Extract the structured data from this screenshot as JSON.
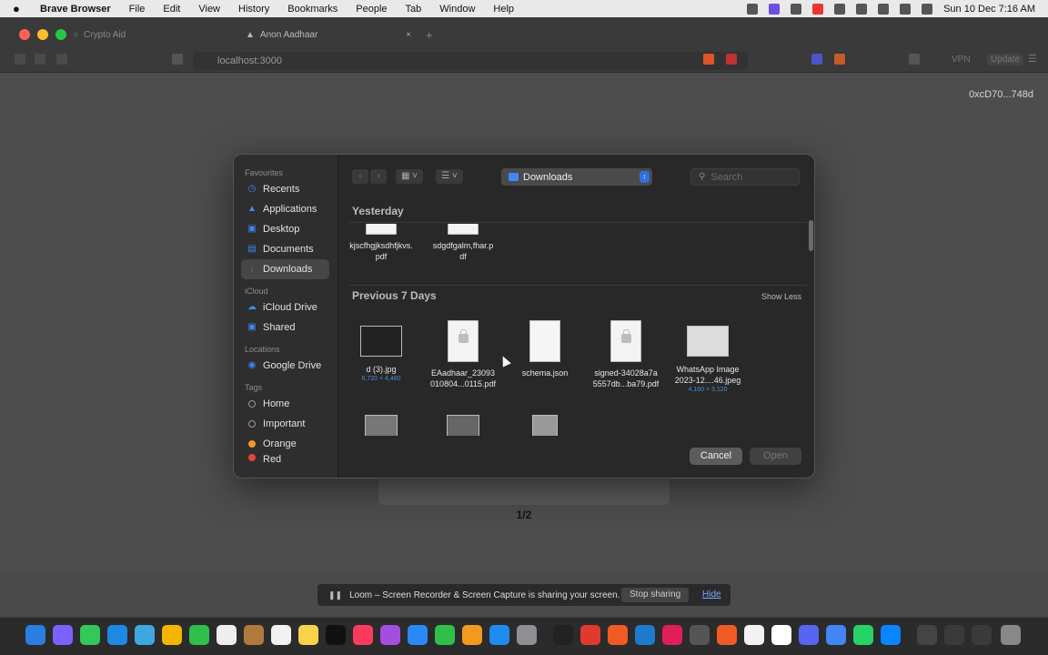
{
  "menubar": {
    "app_name": "Brave Browser",
    "menus": [
      "File",
      "Edit",
      "View",
      "History",
      "Bookmarks",
      "People",
      "Tab",
      "Window",
      "Help"
    ],
    "clock": "Sun 10 Dec  7:16 AM"
  },
  "browser": {
    "tabs": [
      {
        "title": "Crypto Aid"
      },
      {
        "title": "Anon Aadhaar"
      }
    ],
    "url": "localhost:3000",
    "vpn_label": "VPN",
    "update_label": "Update"
  },
  "page": {
    "wallet_address": "0xcD70...748d",
    "pager": "1/2"
  },
  "dialog": {
    "sidebar": {
      "favourites_heading": "Favourites",
      "favourites": [
        "Recents",
        "Applications",
        "Desktop",
        "Documents",
        "Downloads"
      ],
      "icloud_heading": "iCloud",
      "icloud": [
        "iCloud Drive",
        "Shared"
      ],
      "locations_heading": "Locations",
      "locations": [
        "Google Drive"
      ],
      "tags_heading": "Tags",
      "tags": [
        "Home",
        "Important",
        "Orange",
        "Red"
      ]
    },
    "location": "Downloads",
    "search_placeholder": "Search",
    "sections": {
      "yesterday": "Yesterday",
      "previous": "Previous 7 Days",
      "show_less": "Show Less"
    },
    "yesterday_files": [
      {
        "name_line1": "kjscfhgjksdhfjkvs.",
        "name_line2": "pdf"
      },
      {
        "name_line1": "sdgdfgalm,fhar.p",
        "name_line2": "df"
      }
    ],
    "previous_files": [
      {
        "name_line1": "d (3).jpg",
        "name_line2": "",
        "meta": "6,720 × 4,480"
      },
      {
        "name_line1": "EAadhaar_23093",
        "name_line2": "010804...0115.pdf",
        "meta": ""
      },
      {
        "name_line1": "schema.json",
        "name_line2": "",
        "meta": ""
      },
      {
        "name_line1": "signed-34028a7a",
        "name_line2": "5557db...ba79.pdf",
        "meta": ""
      },
      {
        "name_line1": "WhatsApp Image",
        "name_line2": "2023-12....46.jpeg",
        "meta": "4,160 × 3,120"
      }
    ],
    "cancel_label": "Cancel",
    "open_label": "Open"
  },
  "loom": {
    "message": "Loom – Screen Recorder & Screen Capture is sharing your screen.",
    "stop_label": "Stop sharing",
    "hide_label": "Hide"
  },
  "colors": {
    "accent": "#3d8af7",
    "tag_orange": "#f09a26",
    "tag_red": "#e5423b"
  }
}
